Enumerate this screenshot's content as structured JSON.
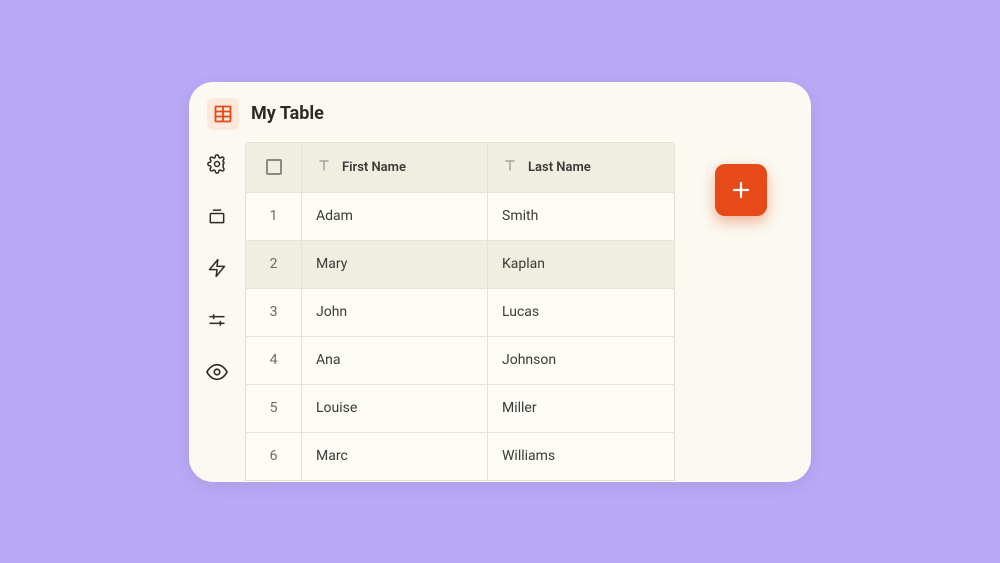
{
  "title": "My Table",
  "columns": {
    "col1": "First Name",
    "col2": "Last Name"
  },
  "rows": [
    {
      "idx": "1",
      "first": "Adam",
      "last": "Smith",
      "highlight": false
    },
    {
      "idx": "2",
      "first": "Mary",
      "last": "Kaplan",
      "highlight": true
    },
    {
      "idx": "3",
      "first": "John",
      "last": "Lucas",
      "highlight": false
    },
    {
      "idx": "4",
      "first": "Ana",
      "last": "Johnson",
      "highlight": false
    },
    {
      "idx": "5",
      "first": "Louise",
      "last": "Miller",
      "highlight": false
    },
    {
      "idx": "6",
      "first": "Marc",
      "last": "Williams",
      "highlight": false
    }
  ],
  "colors": {
    "accent": "#e64a19",
    "surface": "#fbf9f1"
  }
}
